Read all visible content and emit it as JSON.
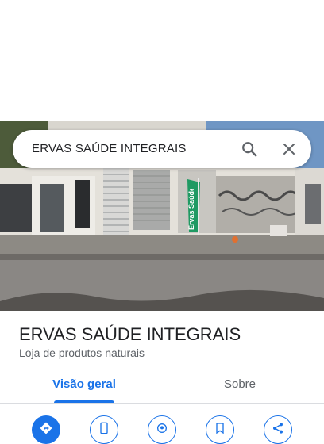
{
  "search": {
    "query": "ERVAS SAÚDE INTEGRAIS"
  },
  "place": {
    "name": "ERVAS SAÚDE INTEGRAIS",
    "category": "Loja de produtos naturais",
    "banner_text": "Ervas Saúde"
  },
  "tabs": [
    {
      "label": "Visão geral",
      "active": true
    },
    {
      "label": "Sobre",
      "active": false
    }
  ],
  "actions": [
    {
      "icon": "directions-icon"
    },
    {
      "icon": "phone-icon"
    },
    {
      "icon": "location-icon"
    },
    {
      "icon": "save-icon"
    },
    {
      "icon": "share-icon"
    }
  ],
  "colors": {
    "accent": "#1a73e8",
    "text": "#202124",
    "secondary_text": "#5f6368",
    "banner": "#1f9a63"
  }
}
